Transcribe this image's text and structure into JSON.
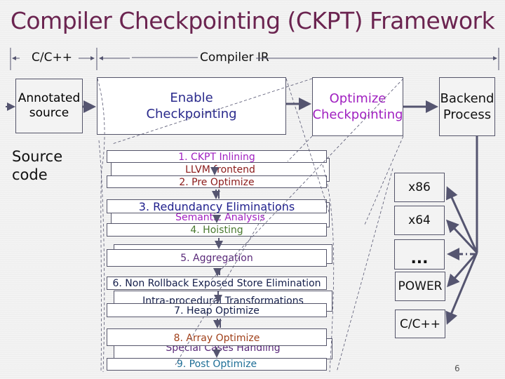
{
  "title": "Compiler Checkpointing (CKPT) Framework",
  "header_ranges": {
    "source_lang": "C/C++",
    "ir": "Compiler IR"
  },
  "left": {
    "annotated_source": [
      "Annotated",
      "source"
    ],
    "source_code": [
      "Source",
      "code"
    ]
  },
  "top_boxes": {
    "enable": [
      "Enable",
      "Checkpointing"
    ],
    "optimize": [
      "Optimize",
      "Checkpointing"
    ],
    "backend": [
      "Backend",
      "Process"
    ]
  },
  "stages": [
    {
      "label": "1. CKPT Inlining",
      "color": "#a020c0"
    },
    {
      "label": "2. Pre Optimize",
      "color": "#8b1a1a"
    },
    {
      "label": "3. Redundancy Eliminations",
      "color": "#1e1e8c"
    },
    {
      "label": "4. Hoisting",
      "color": "#4a7a30"
    },
    {
      "label": "5. Aggregation",
      "color": "#5a2a7a"
    },
    {
      "label": "6. Non Rollback Exposed Store Elimination",
      "color": "#141e4a"
    },
    {
      "label": "7. Heap Optimize",
      "color": "#141e4a"
    },
    {
      "label": "8. Array Optimize",
      "color": "#a0401a"
    },
    {
      "label": "9. Post Optimize",
      "color": "#1e6e96"
    }
  ],
  "background_stages": {
    "llvm_frontend": {
      "label": "LLVM frontend",
      "color": "#8b1a1a"
    },
    "analysis": {
      "label": "Semantic Analysis",
      "color": "#a020c0"
    },
    "intra": {
      "label": "Intra-procedural Transformations",
      "color": "#141e4a"
    },
    "special": {
      "label": "Special Cases Handling",
      "color": "#5a2a7a"
    }
  },
  "targets": [
    "x86",
    "x64",
    "...",
    "POWER",
    "C/C++"
  ],
  "page_number": "6",
  "colors": {
    "title": "#6b2450",
    "enable": "#2a2a8c",
    "optimize": "#a020c0",
    "arrow": "#555570"
  }
}
